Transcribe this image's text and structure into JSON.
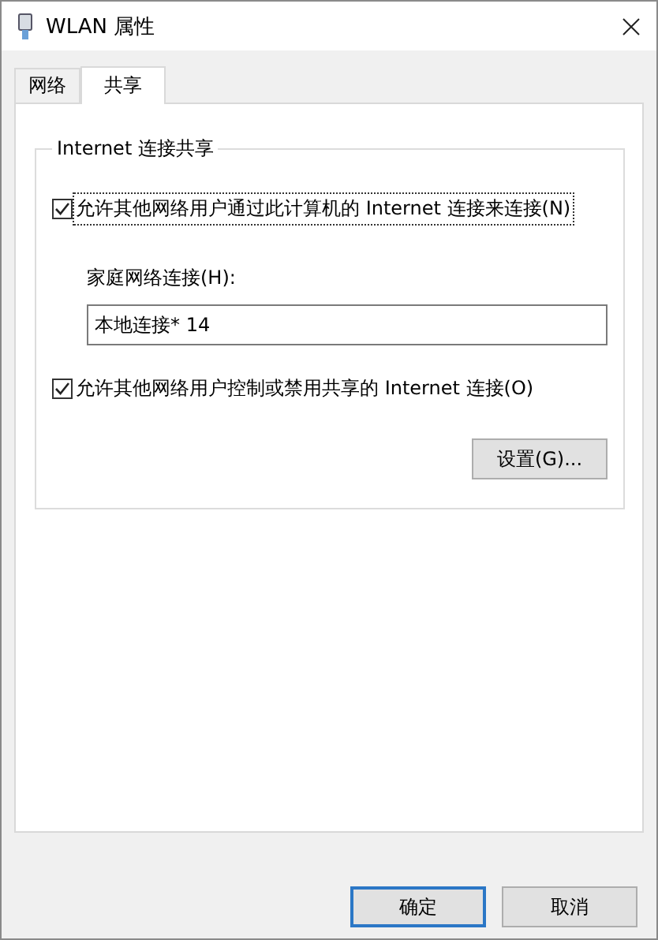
{
  "window": {
    "title": "WLAN 属性"
  },
  "tabs": [
    {
      "label": "网络",
      "selected": false
    },
    {
      "label": "共享",
      "selected": true
    }
  ],
  "group": {
    "title": "Internet 连接共享",
    "options": [
      {
        "label": "允许其他网络用户通过此计算机的 Internet 连接来连接(N)",
        "checked": true,
        "focused": true
      },
      {
        "label": "允许其他网络用户控制或禁用共享的 Internet 连接(O)",
        "checked": true,
        "focused": false
      }
    ],
    "home_connection": {
      "label": "家庭网络连接(H):",
      "value": "本地连接* 14"
    },
    "settings_button": "设置(G)..."
  },
  "buttons": [
    {
      "label": "确定",
      "default": true
    },
    {
      "label": "取消",
      "default": false
    }
  ]
}
